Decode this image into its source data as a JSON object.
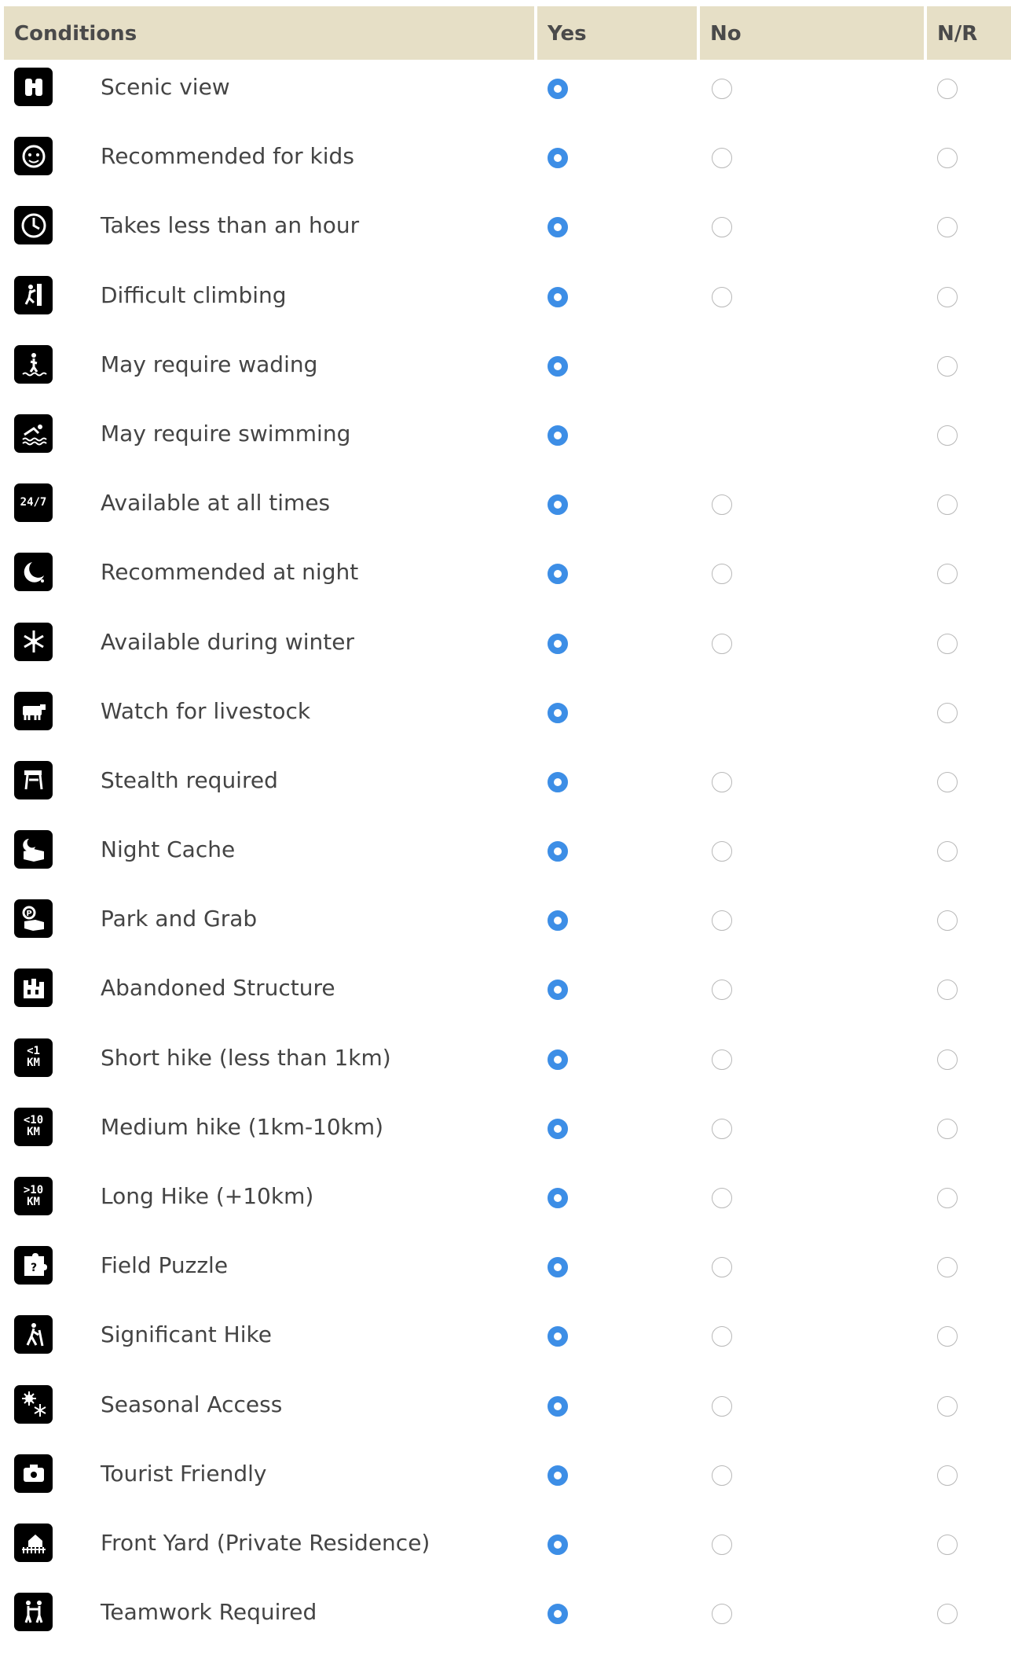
{
  "header": {
    "conditions": "Conditions",
    "yes": "Yes",
    "no": "No",
    "nr": "N/R"
  },
  "colors": {
    "header_bg": "#e6dfc6",
    "accent_radio": "#3d8ee6"
  },
  "rows": [
    {
      "label": "Scenic view",
      "icon": "binoculars-icon",
      "icon_text": "",
      "selected": "yes",
      "no_option": true
    },
    {
      "label": "Recommended for kids",
      "icon": "kid-face-icon",
      "icon_text": "",
      "selected": "yes",
      "no_option": true
    },
    {
      "label": "Takes less than an hour",
      "icon": "clock-icon",
      "icon_text": "",
      "selected": "yes",
      "no_option": true
    },
    {
      "label": "Difficult climbing",
      "icon": "climber-icon",
      "icon_text": "",
      "selected": "yes",
      "no_option": true
    },
    {
      "label": "May require wading",
      "icon": "wading-icon",
      "icon_text": "",
      "selected": "yes",
      "no_option": false
    },
    {
      "label": "May require swimming",
      "icon": "swimmer-icon",
      "icon_text": "",
      "selected": "yes",
      "no_option": false
    },
    {
      "label": "Available at all times",
      "icon": "24-7-icon",
      "icon_text": "24/7",
      "selected": "yes",
      "no_option": true
    },
    {
      "label": "Recommended at night",
      "icon": "moon-icon",
      "icon_text": "",
      "selected": "yes",
      "no_option": true
    },
    {
      "label": "Available during winter",
      "icon": "snowflake-icon",
      "icon_text": "",
      "selected": "yes",
      "no_option": true
    },
    {
      "label": "Watch for livestock",
      "icon": "cow-icon",
      "icon_text": "",
      "selected": "yes",
      "no_option": false
    },
    {
      "label": "Stealth required",
      "icon": "stealth-icon",
      "icon_text": "",
      "selected": "yes",
      "no_option": true
    },
    {
      "label": "Night Cache",
      "icon": "night-cache-icon",
      "icon_text": "",
      "selected": "yes",
      "no_option": true
    },
    {
      "label": "Park and Grab",
      "icon": "park-and-grab-icon",
      "icon_text": "",
      "selected": "yes",
      "no_option": true
    },
    {
      "label": "Abandoned Structure",
      "icon": "abandoned-structure-icon",
      "icon_text": "",
      "selected": "yes",
      "no_option": true
    },
    {
      "label": "Short hike (less than 1km)",
      "icon": "short-hike-icon",
      "icon_text": "<1\nKM",
      "selected": "yes",
      "no_option": true
    },
    {
      "label": "Medium hike (1km-10km)",
      "icon": "medium-hike-icon",
      "icon_text": "<10\nKM",
      "selected": "yes",
      "no_option": true
    },
    {
      "label": "Long Hike (+10km)",
      "icon": "long-hike-icon",
      "icon_text": ">10\nKM",
      "selected": "yes",
      "no_option": true
    },
    {
      "label": "Field Puzzle",
      "icon": "puzzle-icon",
      "icon_text": "",
      "selected": "yes",
      "no_option": true
    },
    {
      "label": "Significant Hike",
      "icon": "hiker-icon",
      "icon_text": "",
      "selected": "yes",
      "no_option": true
    },
    {
      "label": "Seasonal Access",
      "icon": "seasonal-icon",
      "icon_text": "",
      "selected": "yes",
      "no_option": true
    },
    {
      "label": "Tourist Friendly",
      "icon": "tourist-icon",
      "icon_text": "",
      "selected": "yes",
      "no_option": true
    },
    {
      "label": "Front Yard (Private Residence)",
      "icon": "front-yard-icon",
      "icon_text": "",
      "selected": "yes",
      "no_option": true
    },
    {
      "label": "Teamwork Required",
      "icon": "teamwork-icon",
      "icon_text": "",
      "selected": "yes",
      "no_option": true
    }
  ]
}
